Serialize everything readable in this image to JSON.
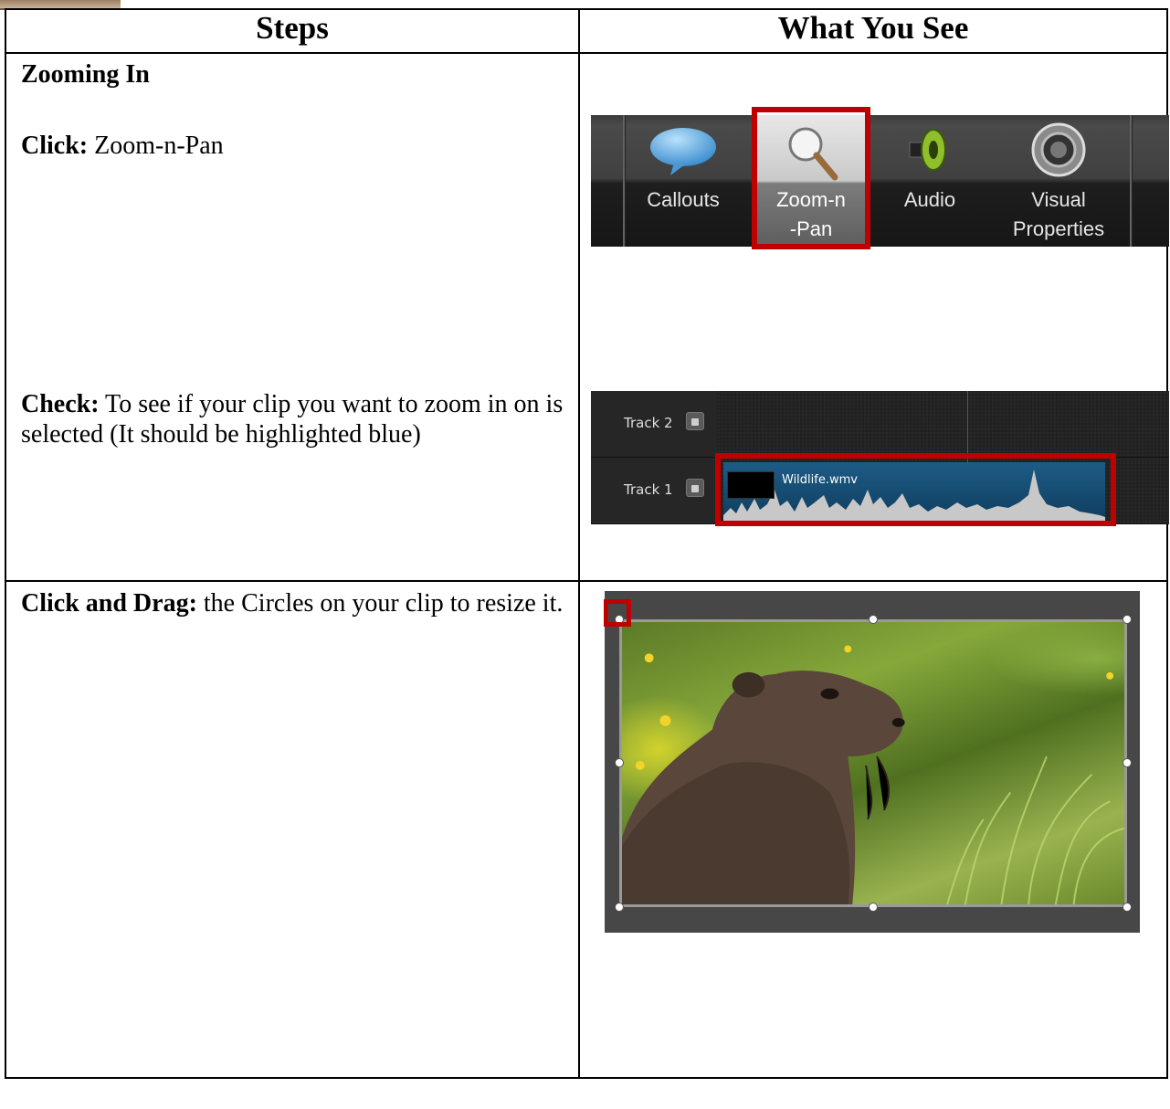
{
  "table": {
    "header": {
      "col1": "Steps",
      "col2": "What You See"
    },
    "row1": {
      "section_title": "Zooming In",
      "step1": {
        "bold": "Click:",
        "text": " Zoom-n-Pan"
      },
      "step2": {
        "bold": "Check:",
        "text": " To see if your clip you want to zoom in on is selected (It should be highlighted blue)"
      }
    },
    "row2": {
      "step": {
        "bold": "Click and Drag:",
        "text": " the Circles on your clip to resize it."
      }
    }
  },
  "toolbar": {
    "buttons": [
      {
        "label": "Callouts",
        "icon": "speech-bubble-icon"
      },
      {
        "label": "Zoom-n-Pan",
        "icon": "magnifier-icon",
        "active": true
      },
      {
        "label": "Audio",
        "icon": "speaker-icon"
      },
      {
        "label": "Visual Properties",
        "icon": "gear-icon"
      }
    ]
  },
  "timeline": {
    "tracks": [
      {
        "name": "Track 2"
      },
      {
        "name": "Track 1"
      }
    ],
    "clip_name": "Wildlife.wmv"
  },
  "colors": {
    "highlight_red": "#c00000",
    "clip_blue": "#1d5c86"
  }
}
